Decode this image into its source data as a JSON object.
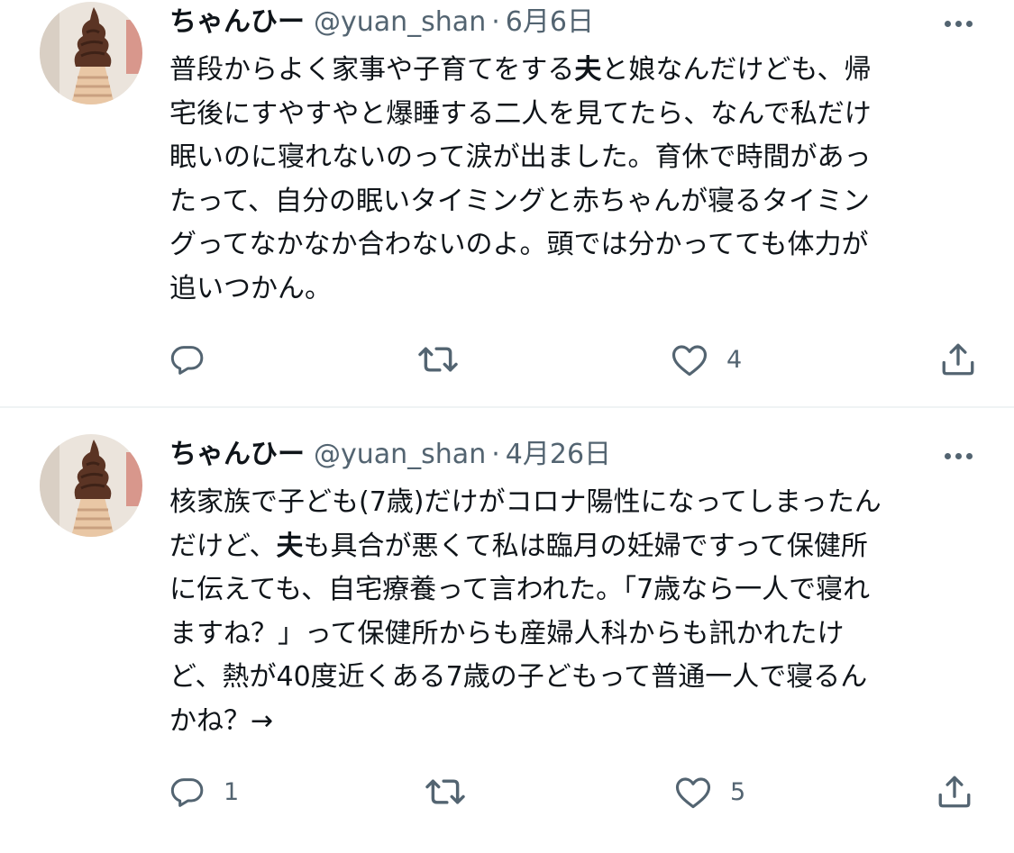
{
  "tweets": [
    {
      "display_name": "ちゃんひー",
      "handle": "@yuan_shan",
      "separator": "·",
      "date": "6月6日",
      "body_lines": [
        [
          "普段からよく家事や子育てをする",
          "夫",
          "と娘なんだけども、帰"
        ],
        [
          "宅後にすやすやと爆睡する二人を見てたら、なんで私だけ"
        ],
        [
          "眠いのに寝れないのって涙が出ました。育休で時間があっ"
        ],
        [
          "たって、自分の眠いタイミングと赤ちゃんが寝るタイミン"
        ],
        [
          "グってなかなか合わないのよ。頭では分かってても体力が"
        ],
        [
          "追いつかん。"
        ]
      ],
      "reply_count": "",
      "retweet_count": "",
      "like_count": "4"
    },
    {
      "display_name": "ちゃんひー",
      "handle": "@yuan_shan",
      "separator": "·",
      "date": "4月26日",
      "body_lines": [
        [
          "核家族で子ども(7歳)だけがコロナ陽性になってしまったん"
        ],
        [
          "だけど、",
          "夫",
          "も具合が悪くて私は臨月の妊婦ですって保健所"
        ],
        [
          "に伝えても、自宅療養って言われた。「7歳なら一人で寝れ"
        ],
        [
          "ますね？」って保健所からも産婦人科からも訊かれたけ"
        ],
        [
          "ど、熱が40度近くある7歳の子どもって普通一人で寝るん"
        ],
        [
          "かね？→"
        ]
      ],
      "reply_count": "1",
      "retweet_count": "",
      "like_count": "5"
    }
  ],
  "icons": {
    "reply": "reply-icon",
    "retweet": "retweet-icon",
    "like": "heart-icon",
    "share": "share-icon",
    "more": "more-icon"
  },
  "colors": {
    "text": "#0f1419",
    "secondary": "#536471",
    "divider": "#eff3f4"
  }
}
